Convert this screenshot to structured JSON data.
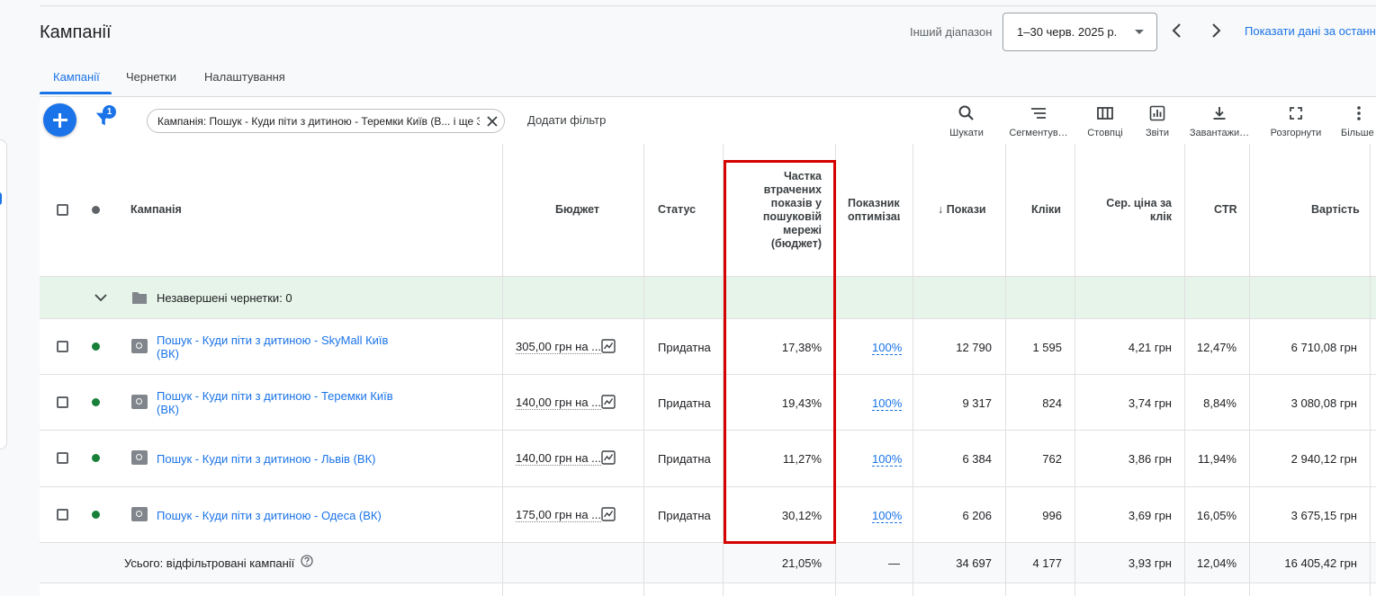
{
  "page": {
    "title": "Кампанії",
    "range_label": "Інший діапазон",
    "date_range": "1–30 черв. 2025 р.",
    "show_data_link": "Показати дані за останн"
  },
  "tabs": [
    {
      "label": "Кампанії",
      "active": true
    },
    {
      "label": "Чернетки",
      "active": false
    },
    {
      "label": "Налаштування",
      "active": false
    }
  ],
  "toolbar": {
    "filter_badge": "1",
    "filter_chip": "Кампанія: Пошук - Куди піти з дитиною - Теремки Київ (В... і ще 3",
    "add_filter": "Додати фільтр",
    "tools": [
      {
        "label": "Шукати",
        "icon": "search-icon"
      },
      {
        "label": "Сегментув…",
        "icon": "segment-icon"
      },
      {
        "label": "Стовпці",
        "icon": "columns-icon"
      },
      {
        "label": "Звіти",
        "icon": "reports-icon"
      },
      {
        "label": "Завантажи…",
        "icon": "download-icon"
      },
      {
        "label": "Розгорнути",
        "icon": "expand-icon"
      },
      {
        "label": "Більше",
        "icon": "more-vert-icon"
      }
    ]
  },
  "table": {
    "headers": {
      "campaign": "Кампанія",
      "budget": "Бюджет",
      "status": "Статус",
      "lost_is": "Частка втрачених показів у пошуковій мережі (бюджет)",
      "opt_score": "Показник оптимізації",
      "impr": "Покази",
      "clicks": "Кліки",
      "avg_cpc": "Сер. ціна за клік",
      "ctr": "CTR",
      "cost": "Вартість"
    },
    "drafts_row": "Незавершені чернетки: 0",
    "rows": [
      {
        "campaign": "Пошук - Куди піти з дитиною - SkyMall Київ (ВК)",
        "budget": "305,00 грн на ...",
        "status": "Придатна",
        "lost_is": "17,38%",
        "opt": "100%",
        "impr": "12 790",
        "clicks": "1 595",
        "cpc": "4,21 грн",
        "ctr": "12,47%",
        "cost": "6 710,08 грн"
      },
      {
        "campaign": "Пошук - Куди піти з дитиною - Теремки Київ (ВК)",
        "budget": "140,00 грн на ...",
        "status": "Придатна",
        "lost_is": "19,43%",
        "opt": "100%",
        "impr": "9 317",
        "clicks": "824",
        "cpc": "3,74 грн",
        "ctr": "8,84%",
        "cost": "3 080,08 грн"
      },
      {
        "campaign": "Пошук - Куди піти з дитиною - Львів (ВК)",
        "budget": "140,00 грн на ...",
        "status": "Придатна",
        "lost_is": "11,27%",
        "opt": "100%",
        "impr": "6 384",
        "clicks": "762",
        "cpc": "3,86 грн",
        "ctr": "11,94%",
        "cost": "2 940,12 грн"
      },
      {
        "campaign": "Пошук - Куди піти з дитиною - Одеса (ВК)",
        "budget": "175,00 грн на ...",
        "status": "Придатна",
        "lost_is": "30,12%",
        "opt": "100%",
        "impr": "6 206",
        "clicks": "996",
        "cpc": "3,69 грн",
        "ctr": "16,05%",
        "cost": "3 675,15 грн"
      }
    ],
    "total": {
      "label": "Усього: відфільтровані кампанії",
      "lost_is": "21,05%",
      "opt": "—",
      "impr": "34 697",
      "clicks": "4 177",
      "cpc": "3,93 грн",
      "ctr": "12,04%",
      "cost": "16 405,42 грн"
    }
  },
  "colors": {
    "accent": "#1a73e8",
    "status_enabled": "#188038",
    "highlight_box": "#d50000",
    "drafts_row_bg": "#e6f4ea"
  }
}
